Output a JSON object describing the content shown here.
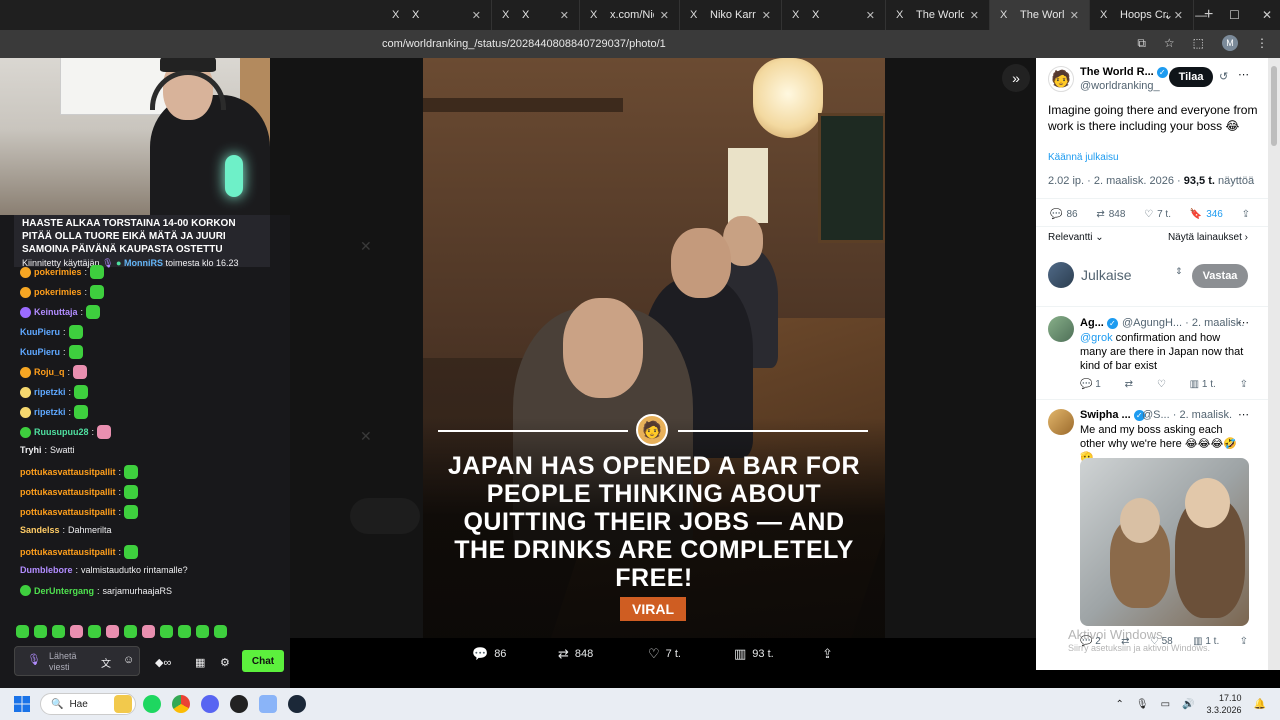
{
  "browser": {
    "tabs": [
      {
        "icon": "X",
        "title": "X",
        "active": false
      },
      {
        "icon": "X",
        "title": "X",
        "active": false
      },
      {
        "icon": "X",
        "title": "x.com/NicHulsc",
        "active": false
      },
      {
        "icon": "X",
        "title": "Niko Karranto",
        "active": false
      },
      {
        "icon": "X",
        "title": "X",
        "active": false
      },
      {
        "icon": "X",
        "title": "The World Ra",
        "active": false
      },
      {
        "icon": "X",
        "title": "The World Ra",
        "active": true
      },
      {
        "icon": "X",
        "title": "Hoops Crave X",
        "active": false
      }
    ],
    "url": "com/worldranking_/status/2028440808840729037/photo/1",
    "profile_initial": "M"
  },
  "photo": {
    "headline": "JAPAN HAS OPENED A BAR FOR PEOPLE THINKING ABOUT QUITTING THEIR JOBS — AND THE DRINKS ARE COMPLETELY FREE!",
    "tag": "VIRAL",
    "actions": {
      "replies": "86",
      "reposts": "848",
      "likes": "7 t.",
      "views": "93 t."
    }
  },
  "tweet": {
    "account_name": "The World R...",
    "handle": "@worldranking_",
    "follow_label": "Tilaa",
    "text": "Imagine going there and everyone from work is there including your boss 😂",
    "translate_label": "Käännä julkaisu",
    "time_date": "2.02 ip. · 2. maalisk. 2026 · ",
    "views_count": "93,5 t.",
    "views_label": " näyttöä",
    "stats": {
      "replies": "86",
      "reposts": "848",
      "likes": "7 t.",
      "bookmarks": "346"
    },
    "sort_label": "Relevantti",
    "quotes_label": "Näytä lainaukset",
    "reply_placeholder": "Julkaise",
    "reply_button": "Vastaa"
  },
  "replies": [
    {
      "name": "Ag...",
      "handle": "@AgungH...",
      "date": "· 2. maalisk.",
      "mention": "@grok",
      "text": " confirmation and how many are there in Japan now that kind of bar exist",
      "stats": {
        "replies": "1",
        "reposts": "",
        "likes": "",
        "views": "1 t."
      }
    },
    {
      "name": "Swipha ...",
      "handle": "@S...",
      "date": "· 2. maalisk.",
      "mention": "",
      "text": "Me and my boss asking each other why we're here 😂😂😂🤣🫡",
      "stats": {
        "replies": "2",
        "reposts": "",
        "likes": "58",
        "views": "1 t."
      }
    }
  ],
  "windows_watermark": {
    "line1": "Aktivoi Windows",
    "line2": "Siirry asetuksiin ja aktivoi Windows."
  },
  "chat": {
    "pinned_text": "HAASTE ALKAA TORSTAINA 14-00 KORKON PITÄÄ OLLA TUORE EIKÄ MÄTÄ JA JUURI SAMOINA PÄIVÄNÄ KAUPASTA OSTETTU",
    "pinned_by_prefix": "Kiinnitetty käyttäjän",
    "pinned_by_user": "MonniRS",
    "pinned_by_suffix": "toimesta klo 16.23",
    "messages": [
      {
        "user": "pokerimies",
        "text": "",
        "color": "#ff9f1c"
      },
      {
        "user": "pokerimies",
        "text": "",
        "color": "#ff9f1c"
      },
      {
        "user": "Keinuttaja",
        "text": "",
        "color": "#b28dff"
      },
      {
        "user": "KuuPieru",
        "text": "",
        "color": "#5fa8ff"
      },
      {
        "user": "KuuPieru",
        "text": "",
        "color": "#5fa8ff"
      },
      {
        "user": "Roju_q",
        "text": "",
        "color": "#ff9f1c"
      },
      {
        "user": "ripetzki",
        "text": "",
        "color": "#5fa8ff"
      },
      {
        "user": "ripetzki",
        "text": "",
        "color": "#5fa8ff"
      },
      {
        "user": "Ruusupuu28",
        "text": "",
        "color": "#4fe0a0"
      },
      {
        "user": "Tryhi",
        "text": "Swatti",
        "color": "#efeff1"
      },
      {
        "user": "pottukasvattausitpallit",
        "text": "",
        "color": "#ff9f1c"
      },
      {
        "user": "pottukasvattausitpallit",
        "text": "",
        "color": "#ff9f1c"
      },
      {
        "user": "pottukasvattausitpallit",
        "text": "",
        "color": "#ff9f1c"
      },
      {
        "user": "Sandelss",
        "text": "Dahmerilta",
        "color": "#ffcc66"
      },
      {
        "user": "pottukasvattausitpallit",
        "text": "",
        "color": "#ff9f1c"
      },
      {
        "user": "Dumblebore",
        "text": "valmistaudutko rintamalle?",
        "color": "#b28dff"
      },
      {
        "user": "DerUntergang",
        "text": "sarjamurhaajaRS",
        "color": "#4fe04f"
      }
    ],
    "input_placeholder": "Lähetä viesti",
    "chat_button": "Chat"
  },
  "taskbar": {
    "search_label": "Hae",
    "time": "17.10",
    "date": "3.3.2026"
  }
}
